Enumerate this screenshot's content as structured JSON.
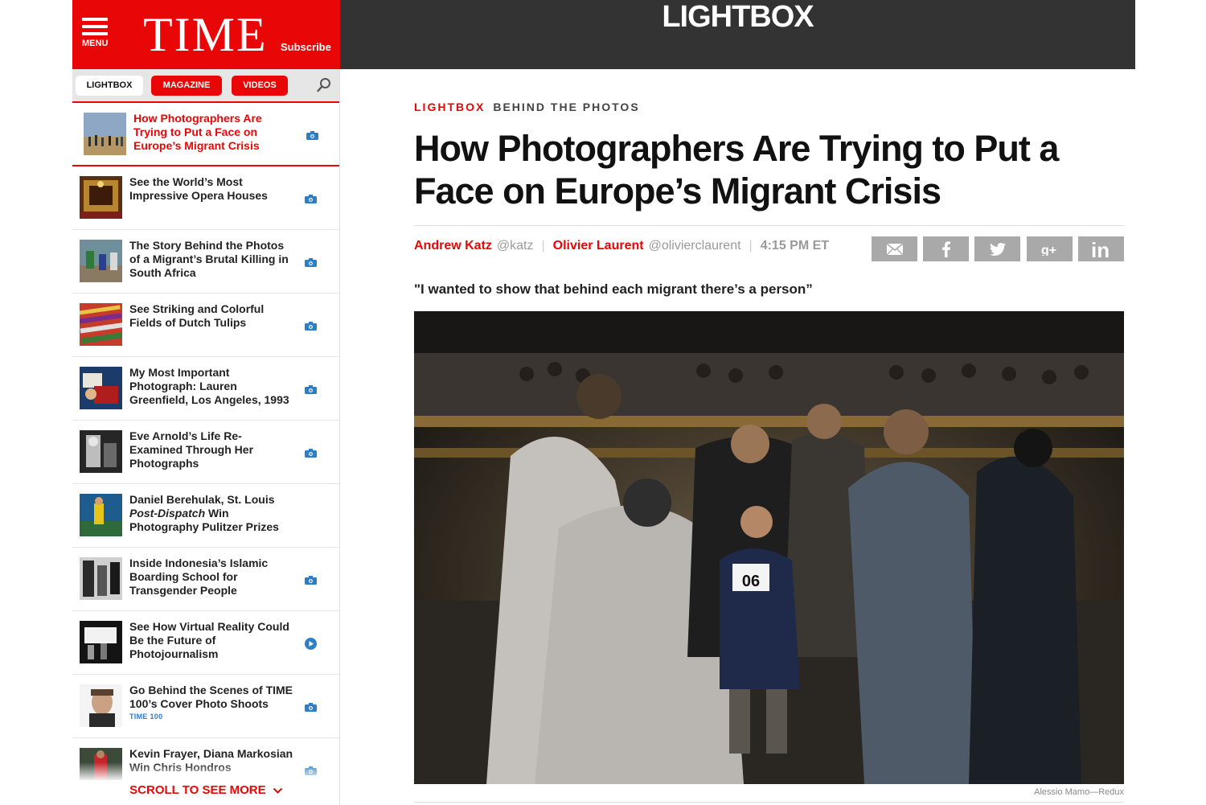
{
  "brand": {
    "menu_label": "MENU",
    "logo": "TIME",
    "subscribe": "Subscribe",
    "color": "#e90606"
  },
  "topbar": {
    "section": "LIGHTBOX"
  },
  "sidebar": {
    "tabs": [
      {
        "label": "LIGHTBOX"
      },
      {
        "label": "MAGAZINE"
      },
      {
        "label": "VIDEOS"
      }
    ],
    "search_icon": "search-icon",
    "items": [
      {
        "title": "How Photographers Are Trying to Put a Face on Europe’s Migrant Crisis",
        "icon": "camera-icon",
        "active": true
      },
      {
        "title": "See the World’s Most Impressive Opera Houses",
        "icon": "camera-icon"
      },
      {
        "title": "The Story Behind the Photos of a Migrant’s Brutal Killing in South Africa",
        "icon": "camera-icon"
      },
      {
        "title": "See Striking and Colorful Fields of Dutch Tulips",
        "icon": "camera-icon"
      },
      {
        "title": "My Most Important Photograph: Lauren Greenfield, Los Angeles, 1993",
        "icon": "camera-icon"
      },
      {
        "title": "Eve Arnold’s Life Re-Examined Through Her Photographs",
        "icon": "camera-icon"
      },
      {
        "title_a": "Daniel Berehulak, St. Louis ",
        "title_b": "Post-Dispatch",
        "title_c": " Win Photography Pulitzer Prizes",
        "icon": "none"
      },
      {
        "title": "Inside Indonesia’s Islamic Boarding School for Transgender People",
        "icon": "camera-icon"
      },
      {
        "title": "See How Virtual Reality Could Be the Future of Photojournalism",
        "icon": "play-icon"
      },
      {
        "title": "Go Behind the Scenes of TIME 100’s Cover Photo Shoots",
        "tag": "TIME 100",
        "icon": "camera-icon"
      },
      {
        "title": "Kevin Frayer, Diana Markosian Win Chris Hondros",
        "icon": "camera-icon"
      }
    ],
    "scroll_more": "SCROLL TO SEE MORE"
  },
  "article": {
    "kicker_section": "LIGHTBOX",
    "kicker_sub": "BEHIND THE PHOTOS",
    "headline": "How Photographers Are Trying to Put a Face on Europe’s Migrant Crisis",
    "authors": [
      {
        "name": "Andrew Katz",
        "handle": "@katz"
      },
      {
        "name": "Olivier Laurent",
        "handle": "@olivierclaurent"
      }
    ],
    "time": "4:15 PM ET",
    "share": [
      "email-icon",
      "facebook-icon",
      "twitter-icon",
      "google-plus-icon",
      "linkedin-icon"
    ],
    "dek": "\"I wanted to show that behind each migrant there’s a person”",
    "photo_tag": "06",
    "credit": "Alessio Mamo—Redux"
  }
}
